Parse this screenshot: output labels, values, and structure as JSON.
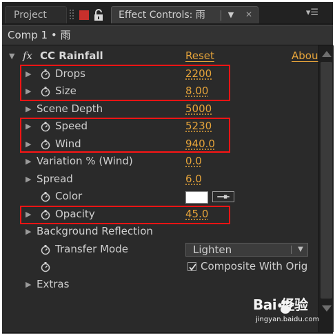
{
  "tabs": {
    "project": "Project",
    "effect_controls": "Effect Controls: 雨"
  },
  "comp_path": "Comp 1 • 雨",
  "effect": {
    "fx_icon": "fx",
    "name": "CC Rainfall",
    "reset": "Reset",
    "about": "Abou"
  },
  "params": {
    "drops": {
      "label": "Drops",
      "value": "2200"
    },
    "size": {
      "label": "Size",
      "value": "8.00"
    },
    "scene_depth": {
      "label": "Scene Depth",
      "value": "5000"
    },
    "speed": {
      "label": "Speed",
      "value": "5230"
    },
    "wind": {
      "label": "Wind",
      "value": "940.0"
    },
    "variation": {
      "label": "Variation % (Wind)",
      "value": "0.0"
    },
    "spread": {
      "label": "Spread",
      "value": "6.0"
    },
    "color": {
      "label": "Color",
      "value": "#ffffff"
    },
    "opacity": {
      "label": "Opacity",
      "value": "45.0"
    },
    "background_reflection": {
      "label": "Background Reflection"
    },
    "transfer_mode": {
      "label": "Transfer Mode",
      "value": "Lighten"
    },
    "composite": {
      "label": "Composite With Orig",
      "checked": true
    },
    "extras": {
      "label": "Extras"
    }
  },
  "highlight_color": "#ff1414",
  "value_color": "#e6a43a",
  "watermark": {
    "logo": "Bai 经验",
    "url": "jingyan.baidu.com"
  },
  "icons": [
    "grip-icon",
    "lock-icon",
    "stopwatch-icon",
    "twirl-arrow-icon",
    "eyedropper-icon",
    "chevron-down-icon",
    "close-icon",
    "panel-menu-icon",
    "checkmark-icon",
    "scroll-up-icon",
    "scroll-down-icon",
    "baidu-paw-icon"
  ]
}
